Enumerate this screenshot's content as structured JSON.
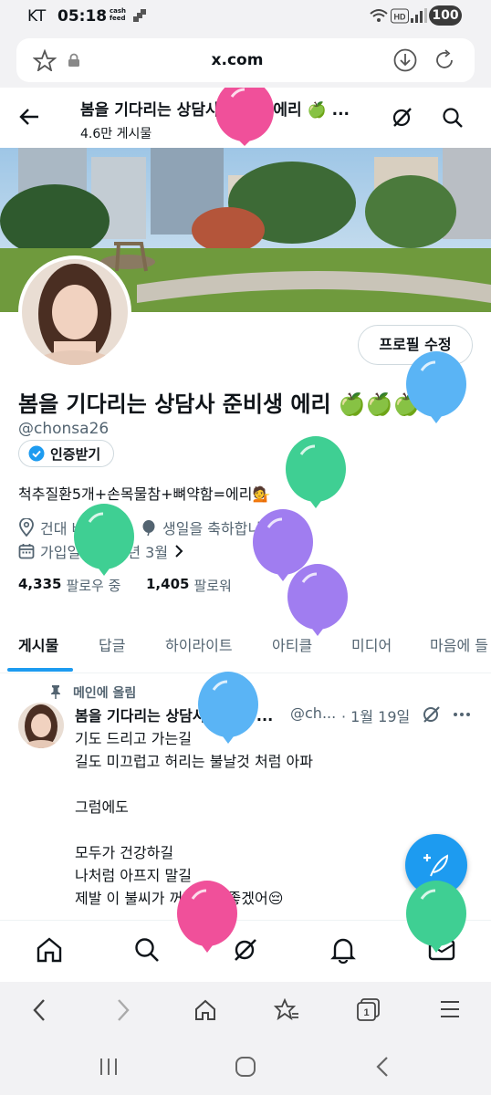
{
  "status_bar": {
    "carrier": "KT",
    "time": "05:18",
    "cash_badge_line1": "cash",
    "cash_badge_line2": "feed",
    "battery": "100"
  },
  "browser": {
    "url": "x.com"
  },
  "header": {
    "title": "봄을 기다리는 상담사 준비생 에리 🍏 ...",
    "posts_count": "4.6만 게시물"
  },
  "profile": {
    "edit_button": "프로필 수정",
    "display_name": "봄을 기다리는 상담사 준비생 에리 🍏🍏🍏",
    "handle": "@chonsa26",
    "verify_button": "인증받기",
    "bio": "척추질환5개+손목물참+뼈약함=에리💁",
    "location": "건대 바로 앞",
    "birthday": "생일을 축하합니다!",
    "joined": "가입일: 2012년 3월",
    "following_count": "4,335",
    "following_label": "팔로우 중",
    "followers_count": "1,405",
    "followers_label": "팔로워"
  },
  "tabs": [
    {
      "label": "게시물",
      "active": true
    },
    {
      "label": "답글",
      "active": false
    },
    {
      "label": "하이라이트",
      "active": false
    },
    {
      "label": "아티클",
      "active": false
    },
    {
      "label": "미디어",
      "active": false
    },
    {
      "label": "마음에 들",
      "active": false
    }
  ],
  "pinned_post": {
    "pinned_label": "메인에 올림",
    "author": "봄을 기다리는 상담사 준비생 ...",
    "handle": "@ch...",
    "date": "· 1월 19일",
    "lines": [
      "기도 드리고 가는길",
      "길도 미끄럽고 허리는 불날것 처럼 아파",
      "",
      "그럼에도",
      "",
      "모두가 건강하길",
      "나처럼 아프지 말길",
      "제발 이 불씨가 꺼졌으면 좋겠어😔"
    ]
  },
  "colors": {
    "accent": "#1d9bf0",
    "text": "#0f1419",
    "muted": "#536471",
    "verified": "#1d9bf0",
    "balloon_pink": "#f0509a",
    "balloon_blue": "#5ab4f5",
    "balloon_green": "#3fcf93",
    "balloon_purple": "#a07df0"
  }
}
